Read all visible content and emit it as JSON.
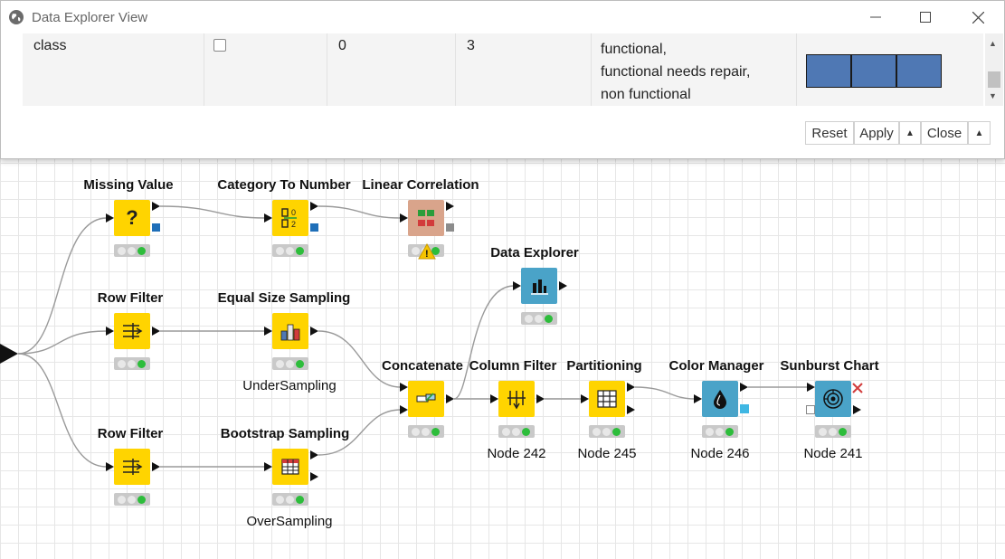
{
  "dialog": {
    "title": "Data Explorer View",
    "window_buttons": [
      "minimize",
      "maximize",
      "close"
    ],
    "row": {
      "column_name": "class",
      "checked": false,
      "missing": "0",
      "unique": "3",
      "values": [
        "functional,",
        "functional needs repair,",
        "non functional"
      ],
      "histogram": [
        1,
        1,
        1
      ],
      "histogram_color": "#4f78b4"
    },
    "buttons": {
      "reset": "Reset",
      "apply": "Apply",
      "close": "Close"
    }
  },
  "workflow": {
    "nodes": [
      {
        "label": "Missing Value",
        "caption": "",
        "icon": "question-mark-icon",
        "glyph": "?"
      },
      {
        "label": "Category To Number",
        "caption": "",
        "icon": "category-to-number-icon",
        "glyph": "0⇄"
      },
      {
        "label": "Linear Correlation",
        "caption": "",
        "icon": "correlation-matrix-icon",
        "glyph": "",
        "warning": "!"
      },
      {
        "label": "Row Filter",
        "caption": "",
        "icon": "row-filter-icon",
        "glyph": "⇉"
      },
      {
        "label": "Equal Size Sampling",
        "caption": "UnderSampling",
        "icon": "bar-chart-icon",
        "glyph": ""
      },
      {
        "label": "Data Explorer",
        "caption": "",
        "icon": "data-explorer-icon",
        "glyph": ""
      },
      {
        "label": "Row Filter",
        "caption": "",
        "icon": "row-filter-icon",
        "glyph": "⇉"
      },
      {
        "label": "Bootstrap Sampling",
        "caption": "OverSampling",
        "icon": "table-icon",
        "glyph": ""
      },
      {
        "label": "Concatenate",
        "caption": "",
        "icon": "concatenate-icon",
        "glyph": ""
      },
      {
        "label": "Column Filter",
        "caption": "Node 242",
        "icon": "column-filter-icon",
        "glyph": ""
      },
      {
        "label": "Partitioning",
        "caption": "Node 245",
        "icon": "partitioning-icon",
        "glyph": ""
      },
      {
        "label": "Color Manager",
        "caption": "Node 246",
        "icon": "color-drop-icon",
        "glyph": ""
      },
      {
        "label": "Sunburst Chart",
        "caption": "Node 241",
        "icon": "sunburst-icon",
        "glyph": ""
      }
    ]
  }
}
